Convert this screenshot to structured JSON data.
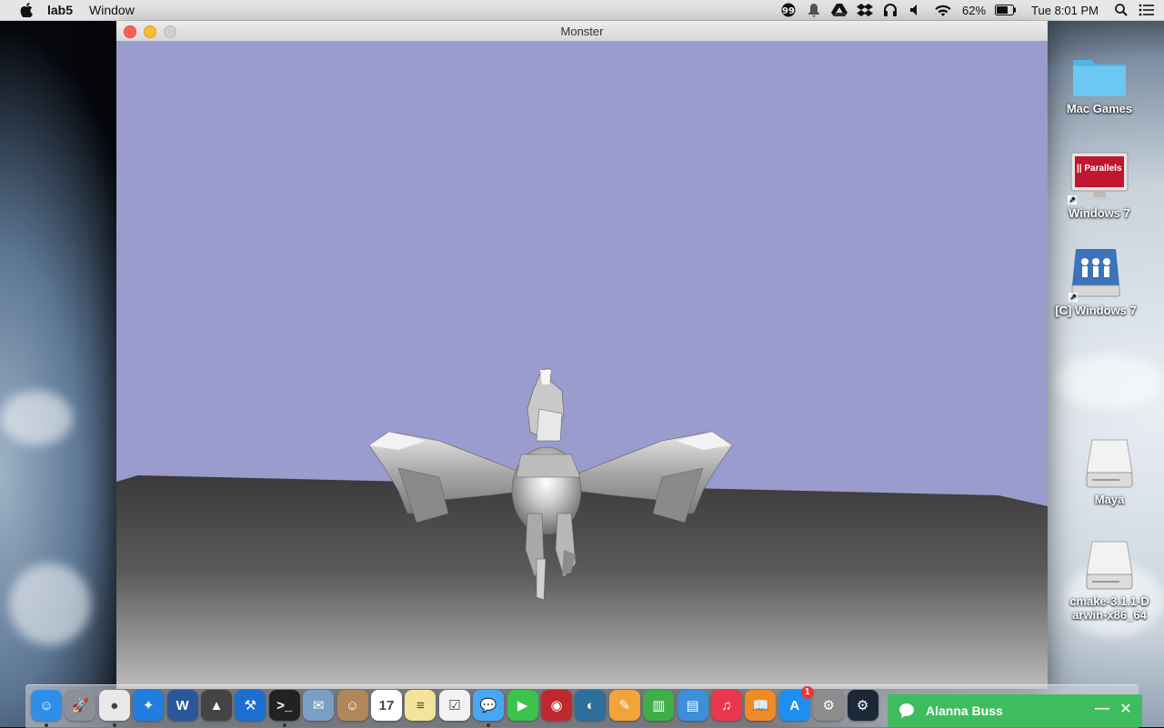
{
  "menubar": {
    "app_name": "lab5",
    "menus": [
      "Window"
    ],
    "battery": "62%",
    "clock": "Tue 8:01 PM"
  },
  "window": {
    "title": "Monster"
  },
  "desktop": {
    "icons": [
      {
        "label": "Mac Games",
        "icon": "folder-icon"
      },
      {
        "label": "Windows 7",
        "icon": "parallels-vm-icon"
      },
      {
        "label": "[C] Windows 7",
        "icon": "network-drive-icon"
      },
      {
        "label": "Maya",
        "icon": "disk-icon"
      },
      {
        "label": "cmake-3.1.1-Darwin-x86_64",
        "icon": "disk-icon"
      }
    ],
    "parallels_logo": "|| Parallels"
  },
  "dock": {
    "apps": [
      {
        "name": "finder-icon",
        "glyph": "☺",
        "color": "#2f8fe8",
        "running": true
      },
      {
        "name": "launchpad-icon",
        "glyph": "🚀",
        "color": "#8a8f99",
        "running": false
      },
      {
        "name": "chrome-icon",
        "glyph": "●",
        "color": "#e9e9e9",
        "running": true
      },
      {
        "name": "safari-icon",
        "glyph": "✦",
        "color": "#1f7ee0",
        "running": false
      },
      {
        "name": "word-icon",
        "glyph": "W",
        "color": "#2b579a",
        "running": false
      },
      {
        "name": "autodesk-icon",
        "glyph": "▲",
        "color": "#444444",
        "running": false
      },
      {
        "name": "xcode-icon",
        "glyph": "⚒",
        "color": "#1b6fd1",
        "running": false
      },
      {
        "name": "terminal-icon",
        "glyph": ">_",
        "color": "#222222",
        "running": true
      },
      {
        "name": "preview-icon",
        "glyph": "✉",
        "color": "#7a9fc4",
        "running": false
      },
      {
        "name": "contacts-icon",
        "glyph": "☺",
        "color": "#b0875a",
        "running": false
      },
      {
        "name": "calendar-icon",
        "glyph": "17",
        "color": "#ffffff",
        "running": false
      },
      {
        "name": "notes-icon",
        "glyph": "≡",
        "color": "#f4e39a",
        "running": false
      },
      {
        "name": "reminders-icon",
        "glyph": "☑",
        "color": "#f2f2f2",
        "running": false
      },
      {
        "name": "messages-icon",
        "glyph": "💬",
        "color": "#46a8f4",
        "running": true
      },
      {
        "name": "facetime-icon",
        "glyph": "▶",
        "color": "#3cc24d",
        "running": false
      },
      {
        "name": "photo-booth-icon",
        "glyph": "◉",
        "color": "#c0282d",
        "running": false
      },
      {
        "name": "iphoto-icon",
        "glyph": "◐",
        "color": "#2d6e9c",
        "running": false
      },
      {
        "name": "pages-icon",
        "glyph": "✎",
        "color": "#f2a33a",
        "running": false
      },
      {
        "name": "numbers-icon",
        "glyph": "▥",
        "color": "#3fae49",
        "running": false
      },
      {
        "name": "keynote-icon",
        "glyph": "▤",
        "color": "#3d8fd9",
        "running": false
      },
      {
        "name": "itunes-icon",
        "glyph": "♫",
        "color": "#e9374c",
        "running": false
      },
      {
        "name": "ibooks-icon",
        "glyph": "📖",
        "color": "#f08a24",
        "running": false
      },
      {
        "name": "app-store-icon",
        "glyph": "A",
        "color": "#1e8ff0",
        "running": false,
        "badge": "1"
      },
      {
        "name": "system-preferences-icon",
        "glyph": "⚙",
        "color": "#8c8c8c",
        "running": false
      },
      {
        "name": "steam-icon",
        "glyph": "⚙",
        "color": "#1b2838",
        "running": false
      }
    ]
  },
  "notification": {
    "contact": "Alanna Buss"
  },
  "colors": {
    "sky": "#999ccc",
    "floor_top": "#3c3c3c",
    "floor_bottom": "#b5b5b5",
    "notify_green": "#3fbd5e"
  }
}
